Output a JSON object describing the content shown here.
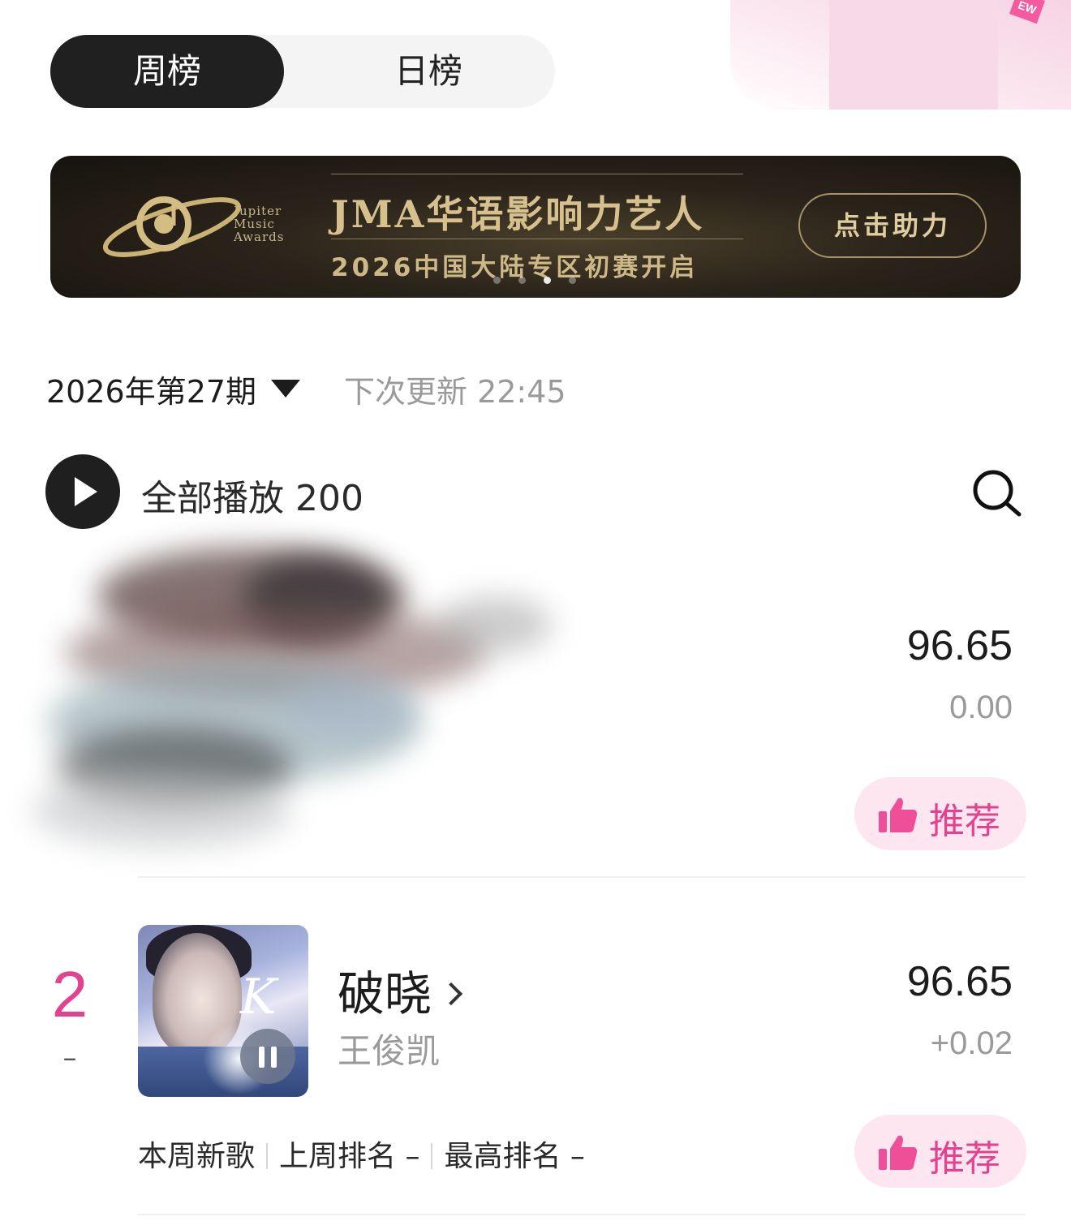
{
  "tabs": [
    {
      "label": "周榜",
      "active": true
    },
    {
      "label": "日榜",
      "active": false
    }
  ],
  "banner": {
    "brand_line1": "Jupiter",
    "brand_line2": "Music",
    "brand_line3": "Awards",
    "title": "JMA华语影响力艺人",
    "subtitle": "2026中国大陆专区初赛开启",
    "cta": "点击助力",
    "slides_total": 4,
    "slide_active": 3
  },
  "period": {
    "label": "2026年第27期",
    "next_update": "下次更新 22:45"
  },
  "play_all": {
    "label": "全部播放 200"
  },
  "rows": [
    {
      "score": "96.65",
      "delta": "0.00",
      "recommend_label": "推荐"
    },
    {
      "rank": "2",
      "rank_change": "–",
      "title": "破晓",
      "artist": "王俊凯",
      "score": "96.65",
      "delta": "+0.02",
      "recommend_label": "推荐",
      "meta": {
        "new": "本周新歌",
        "last_week": "上周排名 –",
        "peak": "最高排名 –"
      }
    }
  ],
  "colors": {
    "accent_pink": "#e14390",
    "recommend_bg": "#fde6f0",
    "tab_active_bg": "#202020",
    "banner_gold": "#d6c08e"
  },
  "icons": [
    "play-icon",
    "search-icon",
    "thumbs-up-icon",
    "pause-icon",
    "chevron-right-icon",
    "caret-down-icon"
  ]
}
